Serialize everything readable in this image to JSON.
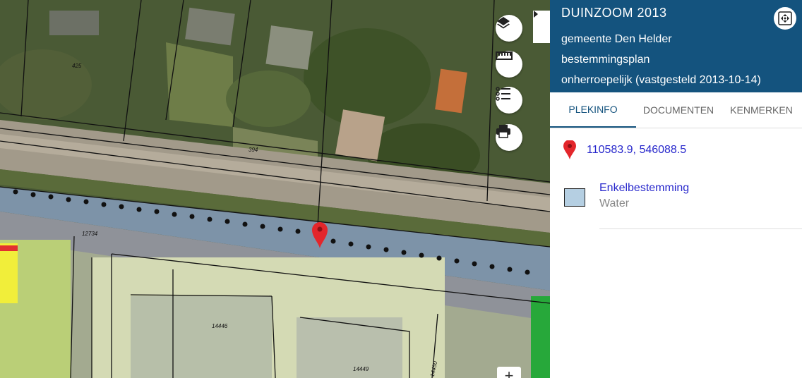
{
  "panel": {
    "title": "DUINZOOM 2013",
    "municipality": "gemeente Den Helder",
    "plan_type": "bestemmingsplan",
    "status": "onherroepelijk (vastgesteld 2013-10-14)",
    "expand_icon": "expand-arrows-icon",
    "header_color": "#14537e"
  },
  "tabs": [
    {
      "label": "PLEKINFO",
      "active": true
    },
    {
      "label": "DOCUMENTEN",
      "active": false
    },
    {
      "label": "KENMERKEN",
      "active": false
    }
  ],
  "location": {
    "coordinates": "110583.9, 546088.5",
    "pin_icon": "map-pin-icon"
  },
  "legend": {
    "title": "Enkelbestemming",
    "subtitle": "Water",
    "swatch_color": "#b5cfe2"
  },
  "map_controls": {
    "layers_icon": "layers-icon",
    "measure_icon": "ruler-icon",
    "legend_icon": "list-icon",
    "print_icon": "printer-icon",
    "collapse_icon": "chevron-right-icon",
    "zoom_in": "+"
  },
  "parcel_labels": [
    "425",
    "394",
    "12734",
    "14446",
    "14449",
    "14450"
  ]
}
